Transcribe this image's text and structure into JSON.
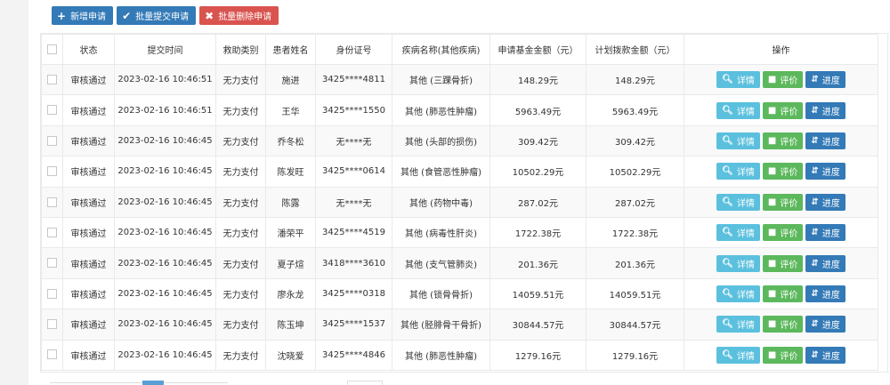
{
  "toolbar": {
    "add_label": "新增申请",
    "batch_submit_label": "批量提交申请",
    "batch_delete_label": "批量删除申请"
  },
  "table": {
    "headers": [
      "状态",
      "提交时间",
      "救助类别",
      "患者姓名",
      "身份证号",
      "疾病名称(其他疾病)",
      "申请基金金额（元）",
      "计划拨款金额（元）",
      "操作"
    ],
    "actions": {
      "detail": "详情",
      "eval": "评价",
      "progress": "进度"
    },
    "rows": [
      {
        "status": "审核通过",
        "time": "2023-02-16 10:46:51",
        "category": "无力支付",
        "name": "施进",
        "id": "3425****4811",
        "disease": "其他 (三踝骨折)",
        "apply": "148.29元",
        "plan": "148.29元"
      },
      {
        "status": "审核通过",
        "time": "2023-02-16 10:46:51",
        "category": "无力支付",
        "name": "王华",
        "id": "3425****1550",
        "disease": "其他 (肺恶性肿瘤)",
        "apply": "5963.49元",
        "plan": "5963.49元"
      },
      {
        "status": "审核通过",
        "time": "2023-02-16 10:46:45",
        "category": "无力支付",
        "name": "乔冬松",
        "id": "无****无",
        "disease": "其他 (头部的损伤)",
        "apply": "309.42元",
        "plan": "309.42元"
      },
      {
        "status": "审核通过",
        "time": "2023-02-16 10:46:45",
        "category": "无力支付",
        "name": "陈发旺",
        "id": "3425****0614",
        "disease": "其他 (食管恶性肿瘤)",
        "apply": "10502.29元",
        "plan": "10502.29元"
      },
      {
        "status": "审核通过",
        "time": "2023-02-16 10:46:45",
        "category": "无力支付",
        "name": "陈露",
        "id": "无****无",
        "disease": "其他 (药物中毒)",
        "apply": "287.02元",
        "plan": "287.02元"
      },
      {
        "status": "审核通过",
        "time": "2023-02-16 10:46:45",
        "category": "无力支付",
        "name": "潘荣平",
        "id": "3425****4519",
        "disease": "其他 (病毒性肝炎)",
        "apply": "1722.38元",
        "plan": "1722.38元"
      },
      {
        "status": "审核通过",
        "time": "2023-02-16 10:46:45",
        "category": "无力支付",
        "name": "夏子煊",
        "id": "3418****3610",
        "disease": "其他 (支气管肺炎)",
        "apply": "201.36元",
        "plan": "201.36元"
      },
      {
        "status": "审核通过",
        "time": "2023-02-16 10:46:45",
        "category": "无力支付",
        "name": "廖永龙",
        "id": "3425****0318",
        "disease": "其他 (锁骨骨折)",
        "apply": "14059.51元",
        "plan": "14059.51元"
      },
      {
        "status": "审核通过",
        "time": "2023-02-16 10:46:45",
        "category": "无力支付",
        "name": "陈玉坤",
        "id": "3425****1537",
        "disease": "其他 (胫腓骨干骨折)",
        "apply": "30844.57元",
        "plan": "30844.57元"
      },
      {
        "status": "审核通过",
        "time": "2023-02-16 10:46:45",
        "category": "无力支付",
        "name": "沈晓爱",
        "id": "3425****4846",
        "disease": "其他 (肺恶性肿瘤)",
        "apply": "1279.16元",
        "plan": "1279.16元"
      }
    ]
  }
}
